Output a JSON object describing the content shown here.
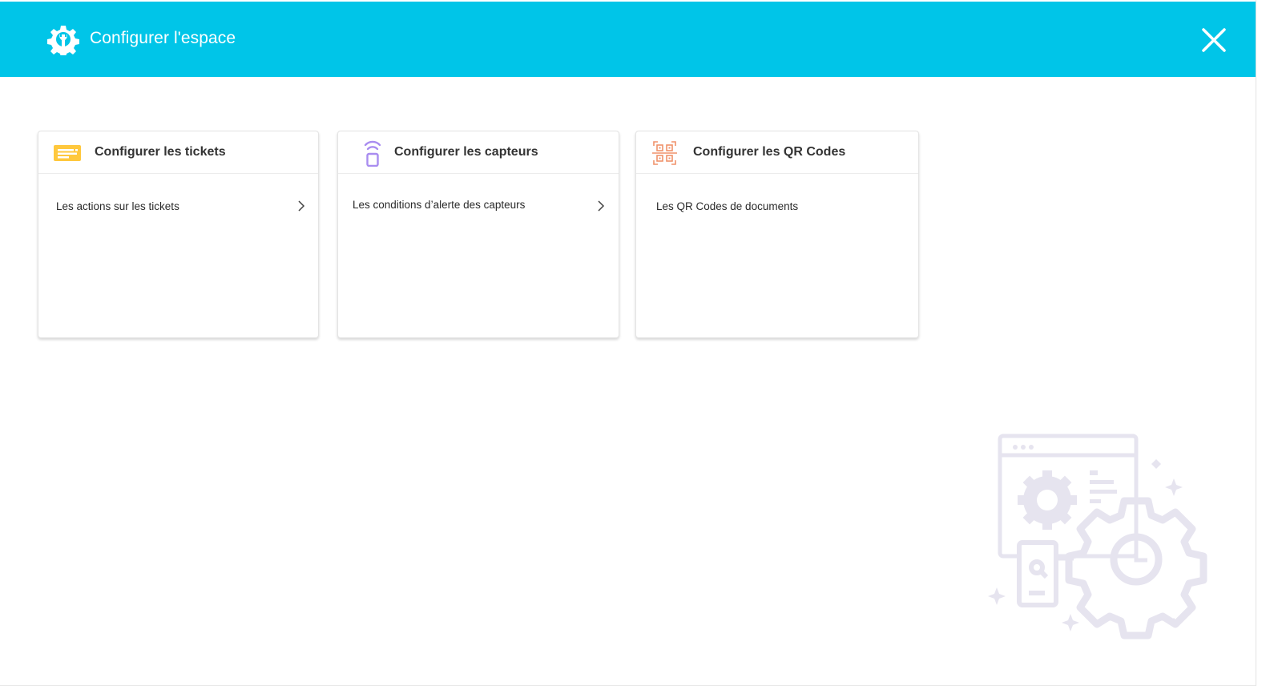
{
  "header": {
    "title": "Configurer l'espace",
    "background_color": "#00c5e8",
    "icon": "gear-wrench-icon",
    "close_icon": "close-icon"
  },
  "cards": [
    {
      "title": "Configurer les tickets",
      "icon": "ticket-icon",
      "icon_color": "#ffc83d",
      "items": [
        {
          "label": "Les actions sur les tickets",
          "has_chevron": true
        }
      ]
    },
    {
      "title": "Configurer les capteurs",
      "icon": "sensor-icon",
      "icon_color": "#a98df0",
      "items": [
        {
          "label": "Les conditions d’alerte des capteurs",
          "has_chevron": true
        }
      ]
    },
    {
      "title": "Configurer les QR Codes",
      "icon": "qr-code-icon",
      "icon_color": "#f0926b",
      "items": [
        {
          "label": "Les QR Codes de documents",
          "has_chevron": false
        }
      ]
    }
  ],
  "illustration": {
    "icon": "settings-illustration",
    "color": "#e6e4ef"
  }
}
